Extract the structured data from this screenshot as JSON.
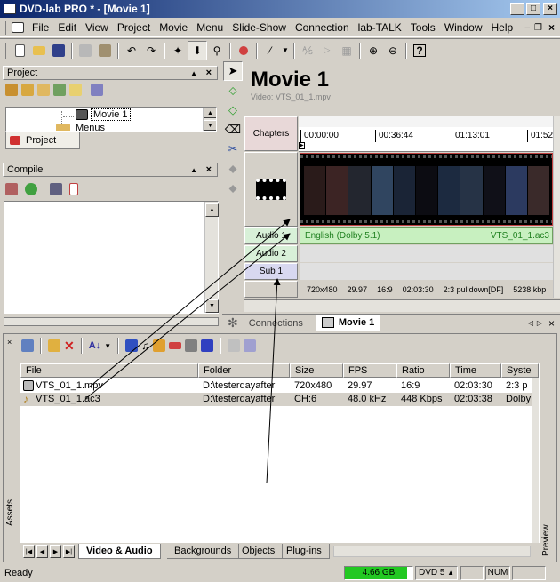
{
  "window": {
    "title": "DVD-lab PRO * - [Movie 1]"
  },
  "menu": [
    "File",
    "Edit",
    "View",
    "Project",
    "Movie",
    "Menu",
    "Slide-Show",
    "Connection",
    "lab-TALK",
    "Tools",
    "Window",
    "Help"
  ],
  "project_panel": {
    "title": "Project",
    "item": "Movie 1",
    "item2": "Menus",
    "tab": "Project"
  },
  "compile_panel": {
    "title": "Compile"
  },
  "movie": {
    "title": "Movie 1",
    "subtitle": "Video: VTS_01_1.mpv"
  },
  "tracks": {
    "chapters": "Chapters",
    "audio1": "Audio 1",
    "audio2": "Audio 2",
    "sub1": "Sub 1",
    "audio_label": "English (Dolby 5.1)",
    "audio_file": "VTS_01_1.ac3"
  },
  "timeline": [
    "00:00:00",
    "00:36:44",
    "01:13:01",
    "01:52:0"
  ],
  "video_info": [
    "720x480",
    "29.97",
    "16:9",
    "02:03:30",
    "2:3 pulldown[DF]",
    "5238 kbp"
  ],
  "doc_tabs": {
    "connections": "Connections",
    "movie": "Movie 1"
  },
  "assets": {
    "columns": [
      "File",
      "Folder",
      "Size",
      "FPS",
      "Ratio",
      "Time",
      "Syste"
    ],
    "rows": [
      [
        "VTS_01_1.mpv",
        "D:\\testerdayafter",
        "720x480",
        "29.97",
        "16:9",
        "02:03:30",
        "2:3 p"
      ],
      [
        "VTS_01_1.ac3",
        "D:\\testerdayafter",
        "CH:6",
        "48.0 kHz",
        "448 Kbps",
        "02:03:38",
        "Dolby"
      ]
    ],
    "side_left": "Assets",
    "side_right": "Preview",
    "tabs": [
      "Video & Audio",
      "Backgrounds",
      "Objects",
      "Plug-ins"
    ]
  },
  "status": {
    "text": "Ready",
    "disk": "4.66 GB",
    "dvd": "DVD 5",
    "num": "NUM"
  },
  "colors": {
    "titlebar": "#0a246a",
    "audio_track": "#c8f0c0",
    "disk_bar": "#22c822"
  }
}
